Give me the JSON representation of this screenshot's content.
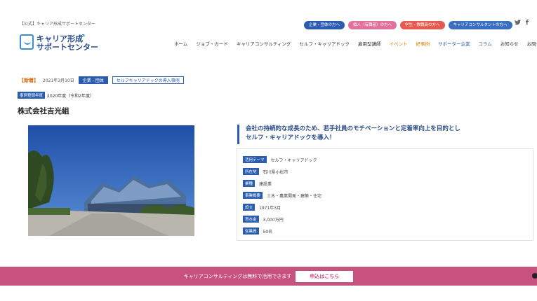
{
  "header": {
    "top_note": "【公式】キャリア形成サポートセンター",
    "pills": [
      {
        "label": "企業・団体の方へ",
        "style": "blue"
      },
      {
        "label": "個人（有職者）の方へ",
        "style": "pink"
      },
      {
        "label": "学生・教職員の方へ",
        "style": "red"
      },
      {
        "label": "キャリアコンサルタントの方へ",
        "style": "blue2"
      }
    ],
    "social": {
      "twitter": "🐦",
      "facebook": "f"
    },
    "logo": {
      "line1": "キャリア形成",
      "line2": "サポートセンター",
      "sub": "キャリア形成サポートセンター"
    },
    "nav": [
      {
        "label": "ホーム",
        "style": ""
      },
      {
        "label": "ジョブ・カード",
        "style": ""
      },
      {
        "label": "キャリアコンサルティング",
        "style": ""
      },
      {
        "label": "セルフ・キャリアドック",
        "style": ""
      },
      {
        "label": "雇用型講師",
        "style": ""
      },
      {
        "label": "イベント",
        "style": "orange"
      },
      {
        "label": "好事例",
        "style": "orange"
      },
      {
        "label": "サポーター企業",
        "style": "blue"
      },
      {
        "label": "コラム",
        "style": "blue"
      },
      {
        "label": "お知らせ",
        "style": ""
      },
      {
        "label": "お問合せ",
        "style": ""
      }
    ]
  },
  "article": {
    "new_tag": "【新着】",
    "date": "2021年3月10日",
    "category": "企業・団体",
    "subcategory": "セルフキャリアドックの導入事例",
    "year_label": "事例登録年度",
    "year_value": "2020年度（令和2年度）",
    "company": "株式会社吉光組",
    "headline_line1": "会社の持続的な成長のため、若手社員のモチベーションと定着率向上を目的とし",
    "headline_line2": "セルフ・キャリアドックを導入！",
    "info": [
      {
        "key": "活用テーマ",
        "value": "セルフ・キャリアドック"
      },
      {
        "key": "所在地",
        "value": "石川県小松市"
      },
      {
        "key": "業種",
        "value": "建設業"
      },
      {
        "key": "事業概要",
        "value": "土木・農業開発・建築・住宅"
      },
      {
        "key": "設立",
        "value": "1971年3月"
      },
      {
        "key": "資本金",
        "value": "3,000万円"
      },
      {
        "key": "従業員",
        "value": "50名"
      }
    ]
  },
  "cta": {
    "text": "キャリアコンサルティングは無料で活用できます",
    "button": "申込はこちら"
  }
}
